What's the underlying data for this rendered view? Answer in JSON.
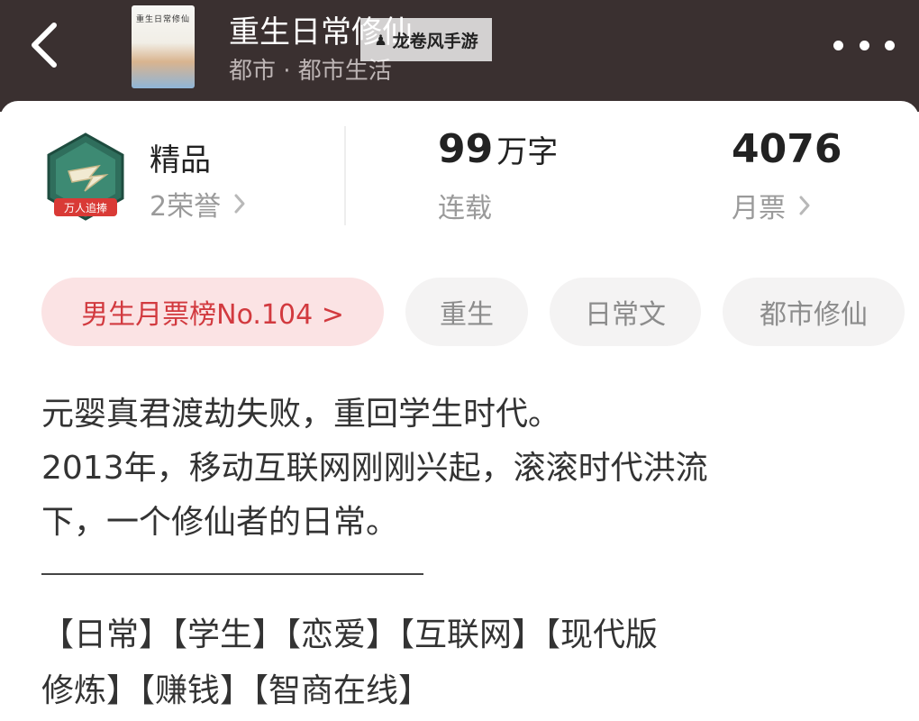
{
  "header": {
    "cover_title": "重生日常修仙",
    "title": "重生日常修仙",
    "category": "都市 · 都市生活",
    "watermark": "龙卷风手游"
  },
  "stats": {
    "quality": "精品",
    "honors": "2荣誉",
    "words_number": "99",
    "words_unit": "万字",
    "words_label": "连载",
    "tickets": "4076",
    "tickets_label": "月票"
  },
  "tags": {
    "rank": "男生月票榜No.104 >",
    "items": [
      "重生",
      "日常文",
      "都市修仙"
    ]
  },
  "description": {
    "lines": [
      "元婴真君渡劫失败，重回学生时代。",
      "2013年，移动互联网刚刚兴起，滚滚时代洪流",
      "下，一个修仙者的日常。"
    ]
  },
  "keywords": {
    "lines": [
      "【日常】【学生】【恋爱】【互联网】【现代版",
      "修炼】【赚钱】【智商在线】"
    ]
  },
  "colors": {
    "header_bg": "#3a3030",
    "rank_tag_bg": "#fbe3e4",
    "rank_tag_text": "#d23a3f",
    "badge_green": "#2f6e5c",
    "badge_red": "#d93a36"
  },
  "icons": {
    "back": "back-arrow-icon",
    "more": "more-dots-icon",
    "badge": "quality-badge-icon",
    "chevron": "chevron-right-icon"
  }
}
